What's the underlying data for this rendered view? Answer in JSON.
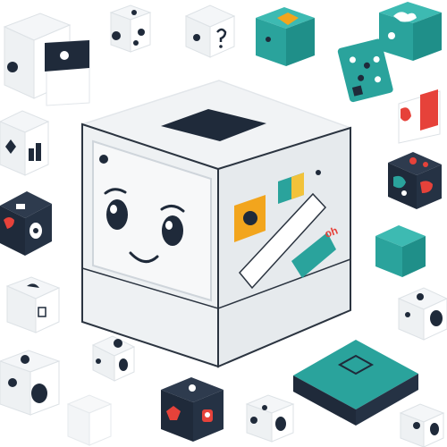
{
  "scene": {
    "palette": {
      "navy": "#1f2a3a",
      "teal": "#2aa39c",
      "teal_dark": "#1f7f7a",
      "orange": "#f2a51d",
      "red": "#e6423a",
      "light_gray": "#eef1f3",
      "mid_gray": "#d7dde2",
      "stroke": "#2b3440"
    },
    "main_box": {
      "label": "oh",
      "icons": [
        "face-icon",
        "sticker-orange",
        "sticker-teal-yellow",
        "sticker-teal"
      ]
    },
    "cubes": [
      {
        "name": "cube-white-top-left",
        "icon": "dots"
      },
      {
        "name": "cube-white-small-top",
        "icon": "dots"
      },
      {
        "name": "cube-white-question",
        "icon": "question-mark"
      },
      {
        "name": "cube-teal-top",
        "icon": "orange-mark"
      },
      {
        "name": "cube-teal-top-right",
        "icon": "white-blob"
      },
      {
        "name": "card-teal-tilted",
        "icon": "dots"
      },
      {
        "name": "card-red-corner",
        "icon": "red-shape"
      },
      {
        "name": "cube-white-left",
        "icon": "plant"
      },
      {
        "name": "cube-navy-left",
        "icon": "monster"
      },
      {
        "name": "cube-white-left-small",
        "icon": "dots"
      },
      {
        "name": "cube-navy-right",
        "icon": "puzzle"
      },
      {
        "name": "cube-teal-right",
        "icon": "plain"
      },
      {
        "name": "cube-white-right",
        "icon": "dots"
      },
      {
        "name": "cube-white-bottom-left",
        "icon": "dots"
      },
      {
        "name": "cube-white-bottom-left-2",
        "icon": "dots"
      },
      {
        "name": "cube-navy-bottom",
        "icon": "robot"
      },
      {
        "name": "cube-white-bottom-center",
        "icon": "dots"
      },
      {
        "name": "platform-teal-bottom-right",
        "icon": "square"
      },
      {
        "name": "cube-white-bottom-right",
        "icon": "dots"
      }
    ]
  }
}
